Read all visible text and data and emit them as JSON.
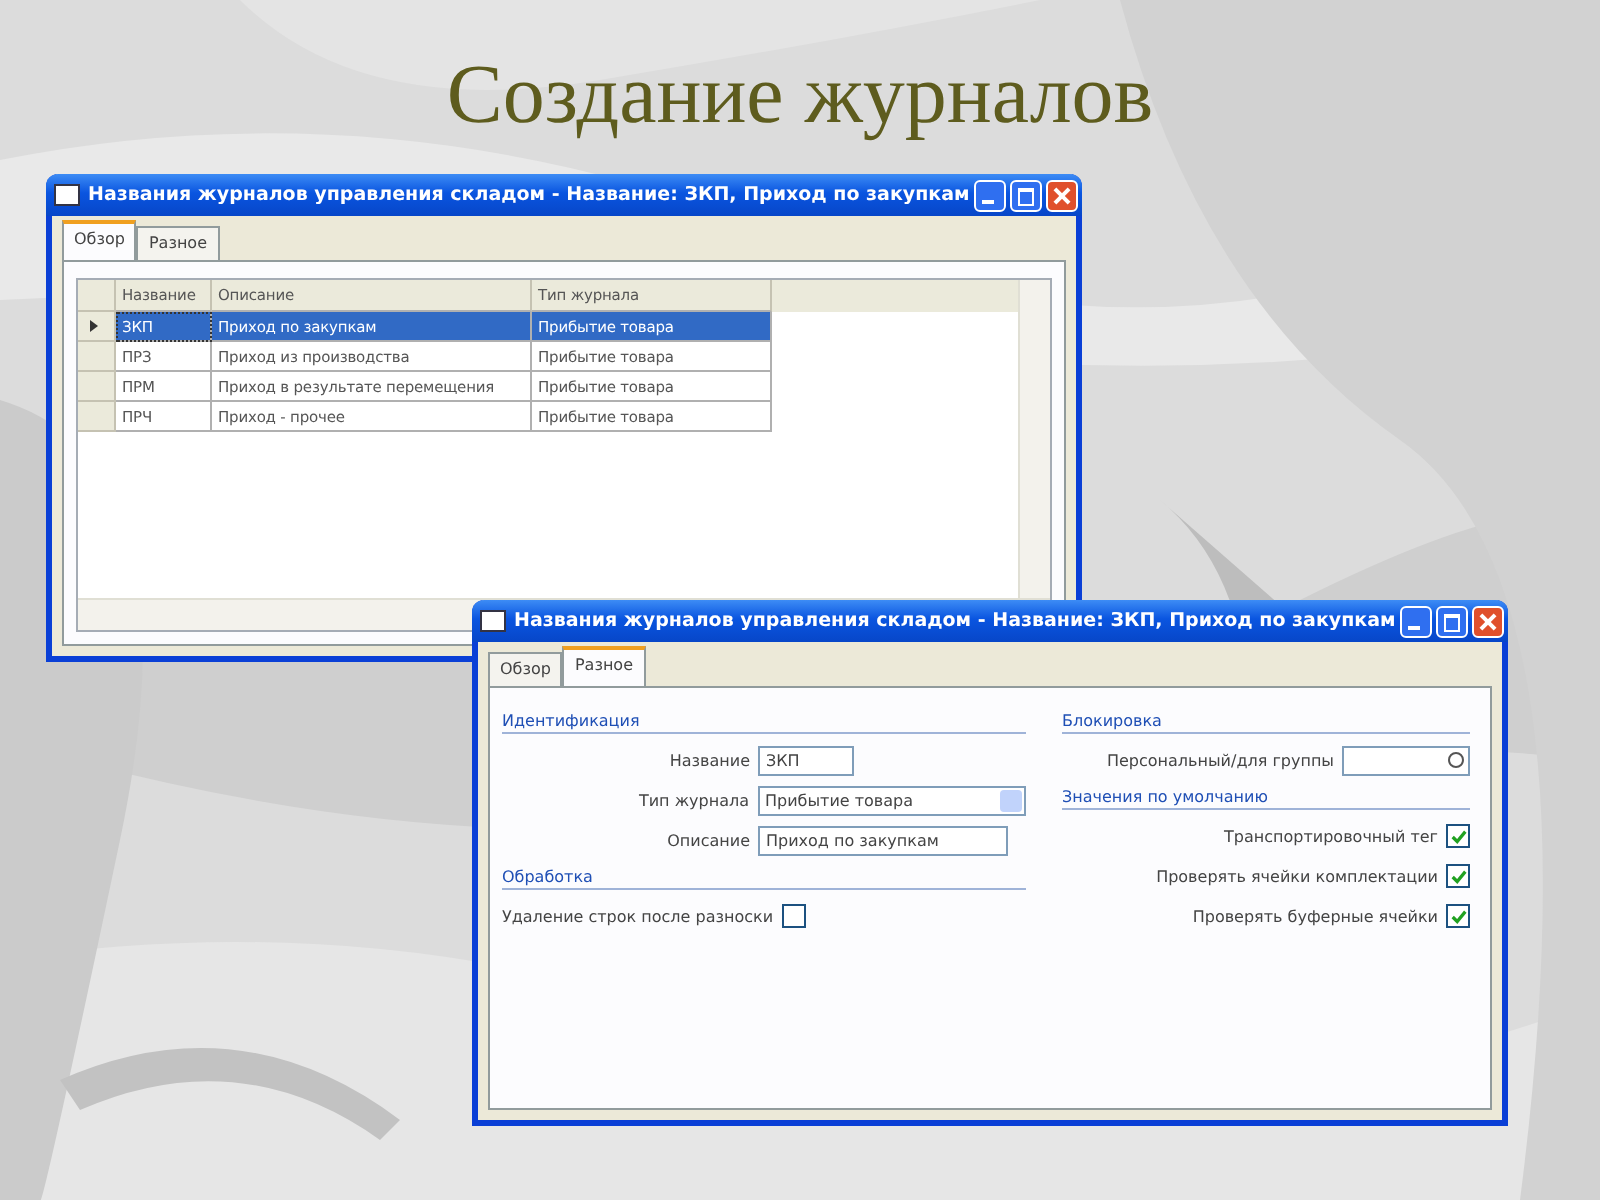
{
  "slide_title": "Создание журналов",
  "windows": [
    {
      "title": "Названия журналов управления складом - Название: ЗКП, Приход по закупкам",
      "kind": "grid",
      "tabs": [
        {
          "label": "Обзор",
          "selected": true
        },
        {
          "label": "Разное",
          "selected": false
        }
      ],
      "grid": {
        "columns": [
          "Название",
          "Описание",
          "Тип журнала"
        ],
        "rows": [
          {
            "cells": [
              "ЗКП",
              "Приход по закупкам",
              "Прибытие товара"
            ],
            "selected": true
          },
          {
            "cells": [
              "ПРЗ",
              "Приход из производства",
              "Прибытие товара"
            ],
            "selected": false
          },
          {
            "cells": [
              "ПРМ",
              "Приход в результате перемещения",
              "Прибытие товара"
            ],
            "selected": false
          },
          {
            "cells": [
              "ПРЧ",
              "Приход - прочее",
              "Прибытие товара"
            ],
            "selected": false
          }
        ]
      }
    },
    {
      "title": "Названия журналов управления складом - Название: ЗКП, Приход по закупкам",
      "kind": "form",
      "tabs": [
        {
          "label": "Обзор",
          "selected": false
        },
        {
          "label": "Разное",
          "selected": true
        }
      ],
      "columns": [
        [
          {
            "heading": "Идентификация",
            "fields": [
              {
                "kind": "text",
                "label": "Название",
                "value": "ЗКП"
              },
              {
                "kind": "select",
                "label": "Тип журнала",
                "value": "Прибытие товара"
              },
              {
                "kind": "text",
                "label": "Описание",
                "value": "Приход по закупкам"
              }
            ]
          },
          {
            "heading": "Обработка",
            "fields": [
              {
                "kind": "checkbox",
                "label": "Удаление строк после разноски",
                "checked": false
              }
            ]
          }
        ],
        [
          {
            "heading": "Блокировка",
            "fields": [
              {
                "kind": "lookup",
                "label": "Персональный/для группы"
              }
            ]
          },
          {
            "heading": "Значения по умолчанию",
            "fields": [
              {
                "kind": "checkbox",
                "label": "Транспортировочный тег",
                "checked": true
              },
              {
                "kind": "checkbox",
                "label": "Проверять ячейки комплектации",
                "checked": true
              },
              {
                "kind": "checkbox",
                "label": "Проверять буферные ячейки",
                "checked": true
              }
            ]
          }
        ]
      ]
    }
  ]
}
